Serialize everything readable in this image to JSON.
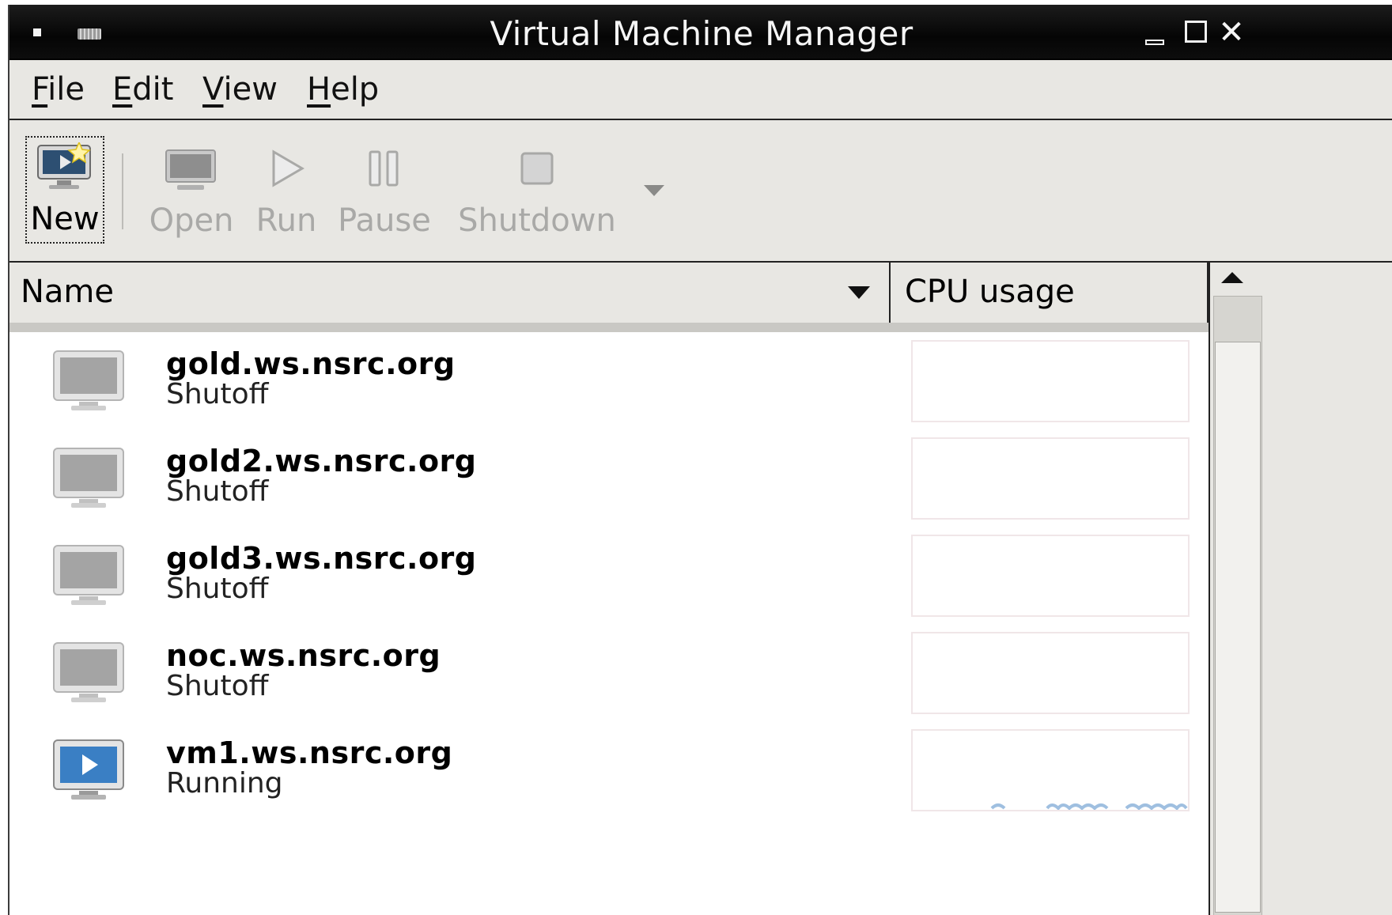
{
  "window": {
    "title": "Virtual Machine Manager"
  },
  "menubar": {
    "items": [
      {
        "mnemonic": "F",
        "rest": "ile"
      },
      {
        "mnemonic": "E",
        "rest": "dit"
      },
      {
        "mnemonic": "V",
        "rest": "iew"
      },
      {
        "mnemonic": "H",
        "rest": "elp"
      }
    ]
  },
  "toolbar": {
    "new_label": "New",
    "open_label": "Open",
    "run_label": "Run",
    "pause_label": "Pause",
    "shutdown_label": "Shutdown"
  },
  "table": {
    "columns": {
      "name": "Name",
      "cpu": "CPU usage"
    },
    "rows": [
      {
        "name": "gold.ws.nsrc.org",
        "status": "Shutoff",
        "state_icon": "vm-off-icon"
      },
      {
        "name": "gold2.ws.nsrc.org",
        "status": "Shutoff",
        "state_icon": "vm-off-icon"
      },
      {
        "name": "gold3.ws.nsrc.org",
        "status": "Shutoff",
        "state_icon": "vm-off-icon"
      },
      {
        "name": "noc.ws.nsrc.org",
        "status": "Shutoff",
        "state_icon": "vm-off-icon"
      },
      {
        "name": "vm1.ws.nsrc.org",
        "status": "Running",
        "state_icon": "vm-running-icon"
      }
    ]
  },
  "colors": {
    "running_accent": "#3a7fc4",
    "cpu_graph": "#9fbfe0",
    "titlebar": "#0a0a0a"
  }
}
